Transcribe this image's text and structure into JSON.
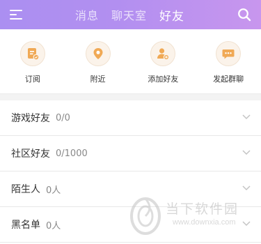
{
  "header": {
    "menu_icon": "menu-icon",
    "tabs": [
      {
        "label": "消息",
        "active": false
      },
      {
        "label": "聊天室",
        "active": false
      },
      {
        "label": "好友",
        "active": true
      }
    ],
    "search_icon": "search-icon",
    "colors": {
      "gradient_start": "#ab8ff1",
      "gradient_end": "#c896ee",
      "text": "#ffffff"
    }
  },
  "actions": [
    {
      "label": "订阅",
      "icon": "subscribe-icon"
    },
    {
      "label": "附近",
      "icon": "location-icon"
    },
    {
      "label": "添加好友",
      "icon": "add-friend-icon"
    },
    {
      "label": "发起群聊",
      "icon": "group-chat-icon"
    }
  ],
  "action_icon_color": "#f0a955",
  "groups": [
    {
      "title": "游戏好友",
      "count": "0/0"
    },
    {
      "title": "社区好友",
      "count": "0/1000"
    },
    {
      "title": "陌生人",
      "count": "0人"
    },
    {
      "title": "黑名单",
      "count": "0人"
    }
  ],
  "watermark": {
    "name": "当下软件园",
    "url": "www.downxia.com"
  }
}
